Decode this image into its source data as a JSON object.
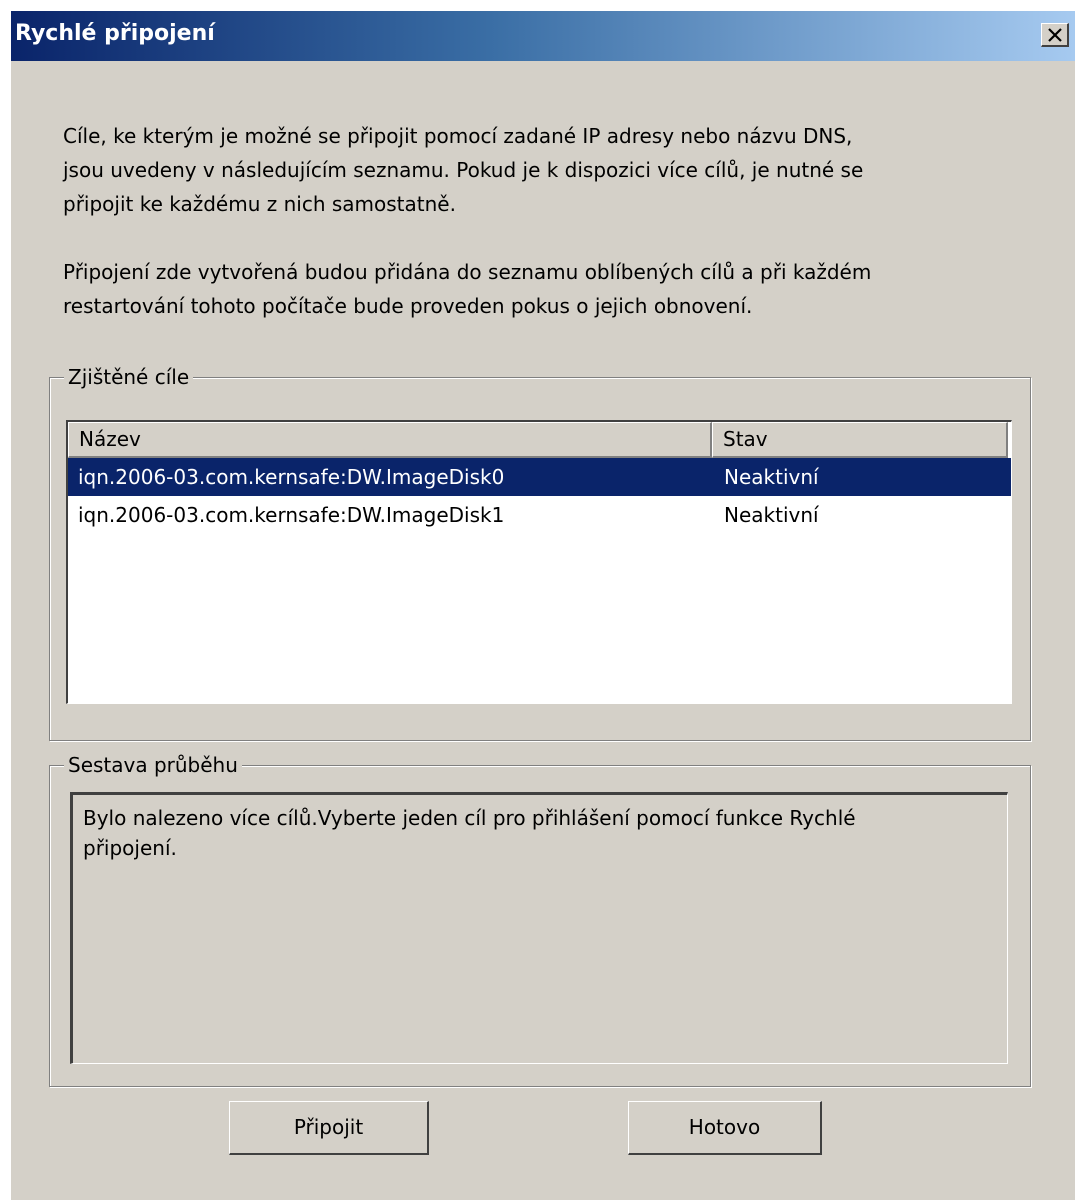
{
  "window": {
    "title": "Rychlé připojení"
  },
  "intro": {
    "lines": [
      "Cíle, ke kterým je možné se připojit pomocí zadané IP adresy nebo názvu DNS,",
      "jsou uvedeny v následujícím seznamu. Pokud je k dispozici více cílů, je nutné se",
      "připojit ke každému z nich samostatně."
    ]
  },
  "note": {
    "lines": [
      "Připojení zde vytvořená budou přidána do seznamu oblíbených cílů a při každém",
      "restartování tohoto počítače bude proveden pokus o jejich obnovení."
    ]
  },
  "targets_group": {
    "label": "Zjištěné cíle",
    "columns": [
      "Název",
      "Stav"
    ],
    "rows": [
      {
        "name": "iqn.2006-03.com.kernsafe:DW.ImageDisk0",
        "status": "Neaktivní",
        "selected": true
      },
      {
        "name": "iqn.2006-03.com.kernsafe:DW.ImageDisk1",
        "status": "Neaktivní",
        "selected": false
      }
    ]
  },
  "progress_group": {
    "label": "Sestava průběhu",
    "lines": [
      "Bylo nalezeno více cílů.Vyberte jeden cíl pro přihlášení pomocí funkce Rychlé",
      "připojení."
    ]
  },
  "buttons": {
    "connect_label": "Připojit",
    "done_label": "Hotovo"
  },
  "icons": {
    "close": "close-icon"
  },
  "colors": {
    "titlebar_start": "#0a246a",
    "titlebar_end": "#a6caf0",
    "dialog_bg": "#d4d0c8",
    "selection_bg": "#0a246a"
  }
}
